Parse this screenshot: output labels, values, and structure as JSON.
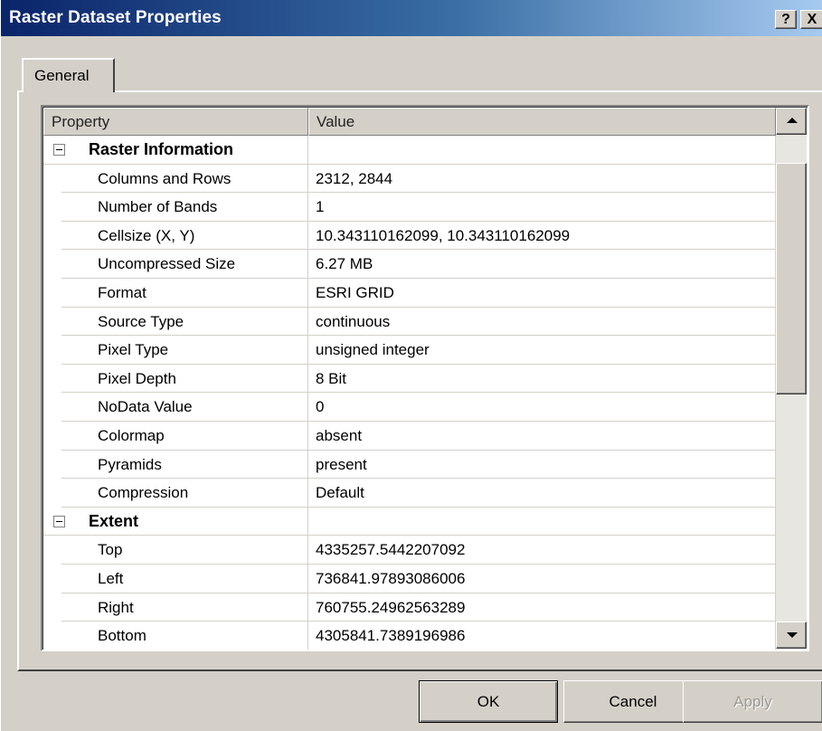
{
  "window": {
    "title": "Raster Dataset Properties",
    "help_label": "?",
    "close_label": "X"
  },
  "tabs": [
    {
      "label": "General",
      "selected": true
    }
  ],
  "grid": {
    "columns": {
      "property": "Property",
      "value": "Value"
    },
    "rows": [
      {
        "type": "category",
        "label": "Raster Information",
        "expanded": true
      },
      {
        "type": "item",
        "property": "Columns and Rows",
        "value": "2312, 2844"
      },
      {
        "type": "item",
        "property": "Number of Bands",
        "value": "1"
      },
      {
        "type": "item",
        "property": "Cellsize (X, Y)",
        "value": "10.343110162099, 10.343110162099"
      },
      {
        "type": "item",
        "property": "Uncompressed Size",
        "value": "6.27 MB"
      },
      {
        "type": "item",
        "property": "Format",
        "value": "ESRI GRID"
      },
      {
        "type": "item",
        "property": "Source Type",
        "value": "continuous"
      },
      {
        "type": "item",
        "property": "Pixel Type",
        "value": "unsigned integer"
      },
      {
        "type": "item",
        "property": "Pixel Depth",
        "value": "8 Bit"
      },
      {
        "type": "item",
        "property": "NoData Value",
        "value": "0"
      },
      {
        "type": "item",
        "property": "Colormap",
        "value": "absent"
      },
      {
        "type": "item",
        "property": "Pyramids",
        "value": "present"
      },
      {
        "type": "item",
        "property": "Compression",
        "value": "Default"
      },
      {
        "type": "category",
        "label": "Extent",
        "expanded": true
      },
      {
        "type": "item",
        "property": "Top",
        "value": "4335257.5442207092"
      },
      {
        "type": "item",
        "property": "Left",
        "value": "736841.97893086006"
      },
      {
        "type": "item",
        "property": "Right",
        "value": "760755.24962563289"
      },
      {
        "type": "item",
        "property": "Bottom",
        "value": "4305841.7389196986"
      }
    ]
  },
  "buttons": {
    "ok": "OK",
    "cancel": "Cancel",
    "apply": "Apply",
    "apply_enabled": false
  }
}
